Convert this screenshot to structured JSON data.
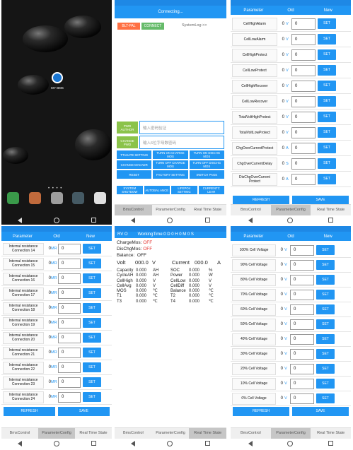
{
  "p1": {
    "status_left": "",
    "status_right": "",
    "app_label": "MY BMS"
  },
  "p2": {
    "status_left": "",
    "status_right": "",
    "top_title": "Connecting...",
    "ble_btn": "BLT-PAL",
    "connect_btn": "CONNECT",
    "syslog": "SystemLog >>",
    "pwd_auth_btn": "PWD AUTHOR",
    "pwd_auth_placeholder": "输入密码验证",
    "change_pwd_btn": "CHANGE PWD",
    "change_pwd_placeholder": "输入6位字母数密码",
    "grid": [
      "TTAHATE SETTING",
      "TURN ON CHARGE MOS",
      "TURN ON DISCHG MOS",
      "CHANGE MACADR",
      "TURN OFF CHARGE MOS",
      "TURN OFF DISCHG MOS",
      "RESET",
      "FACTORY SETTING",
      "SWITCH PAGE",
      "SYSTEM SHUTDOW",
      "AUTOBAL ANCE",
      "LIFEPO4 SETTING",
      "CURRENTC LEAR"
    ],
    "tabs": [
      "BmsControl",
      "ParameterConfig",
      "Real Time State"
    ]
  },
  "p3": {
    "status_left": "",
    "status_right": "",
    "h": [
      "Parameter",
      "Old",
      "New"
    ],
    "rows": [
      {
        "l": "CellHighAlarm",
        "o": "0",
        "u": "V",
        "n": "0"
      },
      {
        "l": "CellLowAlarm",
        "o": "0",
        "u": "V",
        "n": "0"
      },
      {
        "l": "CellHighProtect",
        "o": "0",
        "u": "V",
        "n": "0"
      },
      {
        "l": "CellLowProtect",
        "o": "0",
        "u": "V",
        "n": "0"
      },
      {
        "l": "CellHighRecover",
        "o": "0",
        "u": "V",
        "n": "0"
      },
      {
        "l": "CellLowRecover",
        "o": "0",
        "u": "V",
        "n": "0"
      },
      {
        "l": "TotalVoltHighProtect",
        "o": "0",
        "u": "V",
        "n": "0"
      },
      {
        "l": "TotalVoltLowProtect",
        "o": "0",
        "u": "V",
        "n": "0"
      },
      {
        "l": "ChgOverCurrentProtect",
        "o": "0",
        "u": "A",
        "n": "0"
      },
      {
        "l": "ChgOverCurrentDelay",
        "o": "0",
        "u": "S",
        "n": "0"
      },
      {
        "l": "DisChgOverCurrent Protect",
        "o": "0",
        "u": "A",
        "n": "0"
      }
    ],
    "set": "SET",
    "refresh": "REFRESH",
    "save": "SAVE",
    "tabs": [
      "BmsControl",
      "ParameterConfig",
      "Real Time State"
    ]
  },
  "p4": {
    "status_left": "",
    "status_right": "",
    "h": [
      "Parameter",
      "Old",
      "New"
    ],
    "rows": [
      {
        "l": "Internal resistance Connection 14",
        "o": "0",
        "u": "MR",
        "n": "0"
      },
      {
        "l": "Internal resistance Connection 15",
        "o": "0",
        "u": "MR",
        "n": "0"
      },
      {
        "l": "Internal resistance Connection 16",
        "o": "0",
        "u": "MR",
        "n": "0"
      },
      {
        "l": "Internal resistance Connection 17",
        "o": "0",
        "u": "MR",
        "n": "0"
      },
      {
        "l": "Internal resistance Connection 18",
        "o": "0",
        "u": "MR",
        "n": "0"
      },
      {
        "l": "Internal resistance Connection 19",
        "o": "0",
        "u": "MR",
        "n": "0"
      },
      {
        "l": "Internal resistance Connection 20",
        "o": "0",
        "u": "MR",
        "n": "0"
      },
      {
        "l": "Internal resistance Connection 21",
        "o": "0",
        "u": "MR",
        "n": "0"
      },
      {
        "l": "Internal resistance Connection 22",
        "o": "0",
        "u": "MR",
        "n": "0"
      },
      {
        "l": "Internal resistance Connection 23",
        "o": "0",
        "u": "MR",
        "n": "0"
      },
      {
        "l": "Internal resistance Connection 24",
        "o": "0",
        "u": "MR",
        "n": "0"
      }
    ],
    "set": "SET",
    "refresh": "REFRESH",
    "save": "SAVE",
    "tabs": [
      "BmsControl",
      "ParameterConfig",
      "Real Time State"
    ]
  },
  "p5": {
    "status_left": "",
    "status_right": "",
    "top_left": "RV O",
    "top_title": "WorkingTime:0 D 0 H 0 M 0 S",
    "charge_mos_l": "ChargeMos:",
    "charge_mos_v": "OFF",
    "dischg_mos_l": "DisChgMos:",
    "dischg_mos_v": "OFF",
    "balance_l": "Balance:",
    "balance_v": "OFF",
    "volt_l": "Volt",
    "volt_v": "000.0",
    "volt_u": "V",
    "cur_l": "Current",
    "cur_v": "000.0",
    "cur_u": "A",
    "lines": [
      [
        "Capacity",
        "0.000",
        "AH",
        "SOC",
        "0.000",
        "%"
      ],
      [
        "CycleAH",
        "0.000",
        "AH",
        "Power",
        "0.000",
        "W"
      ],
      [
        "CellHigh",
        "0.000",
        "V",
        "CellLow",
        "0.000",
        "V"
      ],
      [
        "CellAvg",
        "0.000",
        "V",
        "CellDiff",
        "0.000",
        "V"
      ],
      [
        "MOS",
        "0.000",
        "℃",
        "Balance",
        "0.000",
        "℃"
      ],
      [
        "T1",
        "0.000",
        "℃",
        "T2",
        "0.000",
        "℃"
      ],
      [
        "T3",
        "0.000",
        "℃",
        "T4",
        "0.000",
        "℃"
      ]
    ],
    "tabs": [
      "BmsControl",
      "ParameterConfig",
      "Real Time State"
    ]
  },
  "p6": {
    "status_left": "",
    "status_right": "",
    "h": [
      "Parameter",
      "Old",
      "New"
    ],
    "rows": [
      {
        "l": "100% Cell Voltage",
        "o": "0",
        "u": "V",
        "n": "0"
      },
      {
        "l": "90% Cell Voltage",
        "o": "0",
        "u": "V",
        "n": "0"
      },
      {
        "l": "80% Cell Voltage",
        "o": "0",
        "u": "V",
        "n": "0"
      },
      {
        "l": "70% Cell Voltage",
        "o": "0",
        "u": "V",
        "n": "0"
      },
      {
        "l": "60% Cell Voltage",
        "o": "0",
        "u": "V",
        "n": "0"
      },
      {
        "l": "50% Cell Voltage",
        "o": "0",
        "u": "V",
        "n": "0"
      },
      {
        "l": "40% Cell Voltage",
        "o": "0",
        "u": "V",
        "n": "0"
      },
      {
        "l": "30% Cell Voltage",
        "o": "0",
        "u": "V",
        "n": "0"
      },
      {
        "l": "20% Cell Voltage",
        "o": "0",
        "u": "V",
        "n": "0"
      },
      {
        "l": "10% Cell Voltage",
        "o": "0",
        "u": "V",
        "n": "0"
      },
      {
        "l": "0% Cell Voltage",
        "o": "0",
        "u": "V",
        "n": "0"
      }
    ],
    "set": "SET",
    "refresh": "REFRESH",
    "save": "SAVE",
    "tabs": [
      "BmsControl",
      "ParameterConfig",
      "Real Time State"
    ]
  }
}
